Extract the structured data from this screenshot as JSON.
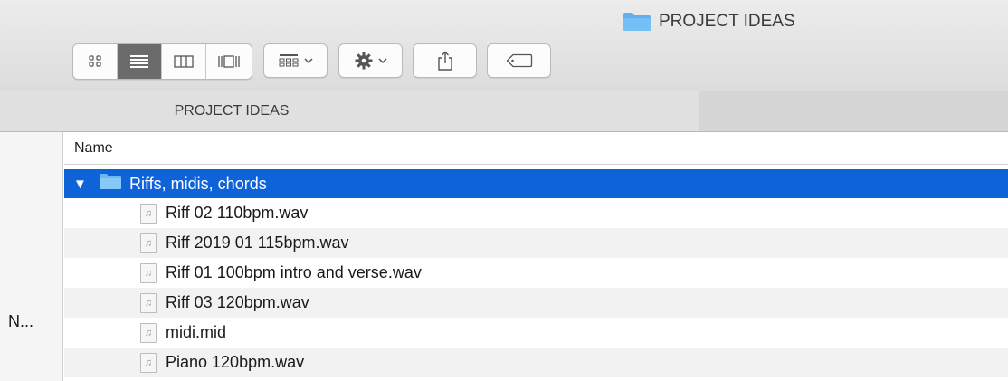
{
  "window": {
    "title": "PROJECT IDEAS"
  },
  "toolbar": {
    "view_buttons": [
      "icon-view",
      "list-view",
      "column-view",
      "cover-flow-view"
    ],
    "active_view": "list-view"
  },
  "pathbar": {
    "folder_name": "PROJECT IDEAS"
  },
  "sidebar": {
    "truncated_label": "N..."
  },
  "list": {
    "column_name": "Name",
    "folder": {
      "name": "Riffs, midis, chords",
      "expanded": true
    },
    "files": [
      {
        "name": "Riff 02 110bpm.wav"
      },
      {
        "name": "Riff 2019 01 115bpm.wav"
      },
      {
        "name": "Riff 01 100bpm intro and verse.wav"
      },
      {
        "name": "Riff 03 120bpm.wav"
      },
      {
        "name": "midi.mid"
      },
      {
        "name": "Piano 120bpm.wav"
      }
    ]
  },
  "colors": {
    "selection": "#0e63d8",
    "folder_blue": "#5fb0f0",
    "toolbar_bg": "#e4e4e4"
  }
}
